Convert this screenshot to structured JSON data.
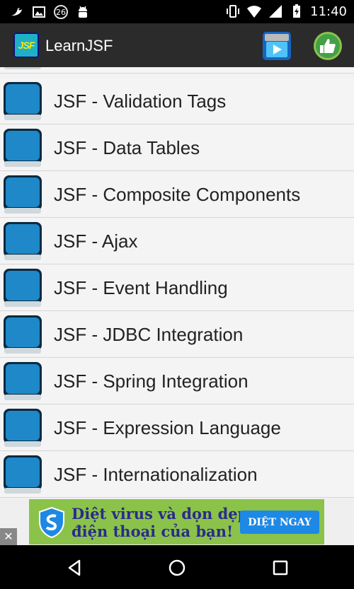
{
  "status_bar": {
    "notification_count": "26",
    "time": "11:40"
  },
  "app_bar": {
    "logo_text": "JSF",
    "title": "LearnJSF"
  },
  "list": {
    "items": [
      {
        "label": ""
      },
      {
        "label": "JSF - Validation Tags"
      },
      {
        "label": "JSF - Data Tables"
      },
      {
        "label": "JSF - Composite Components"
      },
      {
        "label": "JSF - Ajax"
      },
      {
        "label": "JSF - Event Handling"
      },
      {
        "label": "JSF - JDBC Integration"
      },
      {
        "label": "JSF - Spring Integration"
      },
      {
        "label": "JSF - Expression Language"
      },
      {
        "label": "JSF - Internationalization"
      }
    ]
  },
  "ad": {
    "line1": "Diệt virus và dọn dẹp",
    "line2": "điện thoại của bạn!",
    "button_label": "DIỆT NGAY",
    "close_label": "✕"
  },
  "colors": {
    "app_bar": "#2b2b2b",
    "ad_background": "#8bc34a",
    "ad_button": "#1e88e5"
  }
}
